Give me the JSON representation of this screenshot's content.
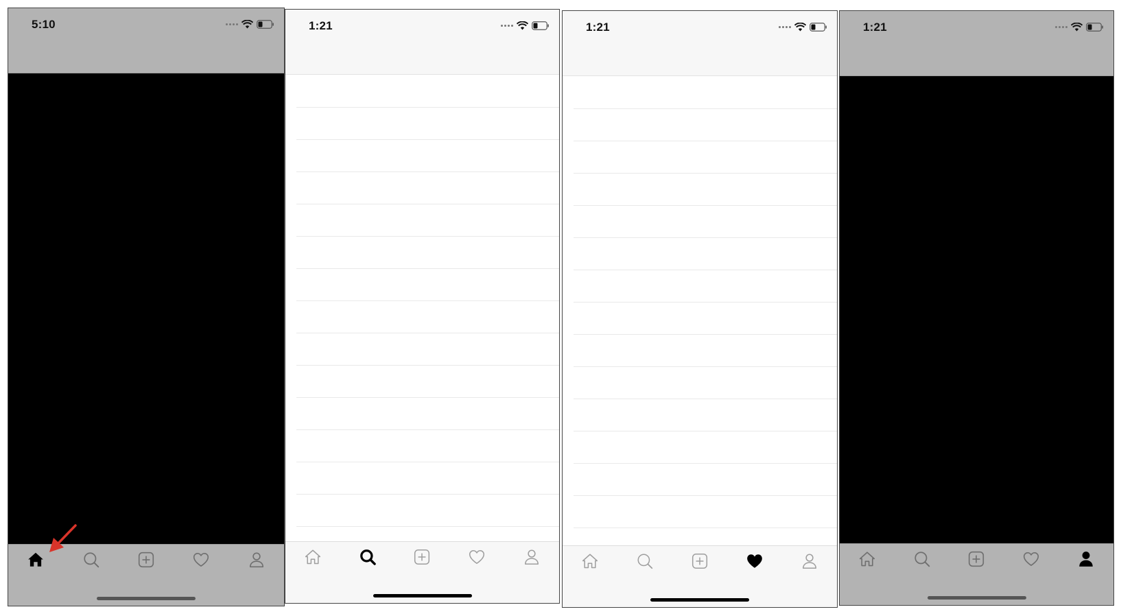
{
  "screens": [
    {
      "time": "5:10",
      "active_tab": "home",
      "overlay": "gray",
      "content": "black",
      "annotation": "red-arrow-pointing-at-home-tab"
    },
    {
      "time": "1:21",
      "active_tab": "search",
      "overlay": "none",
      "content": "empty-list"
    },
    {
      "time": "1:21",
      "active_tab": "activity",
      "overlay": "none",
      "content": "empty-list"
    },
    {
      "time": "1:21",
      "active_tab": "profile",
      "overlay": "gray",
      "content": "black"
    }
  ],
  "tabs": [
    {
      "id": "home",
      "icon": "home-icon"
    },
    {
      "id": "search",
      "icon": "search-icon"
    },
    {
      "id": "add",
      "icon": "add-square-icon"
    },
    {
      "id": "activity",
      "icon": "heart-icon"
    },
    {
      "id": "profile",
      "icon": "person-icon"
    }
  ],
  "colors": {
    "active_icon": "#000000",
    "inactive_icon": "#9e9e9e",
    "inactive_icon_on_gray": "#6f6f6f",
    "overlay_gray": "#b3b3b3",
    "annotation_red": "#d9342a"
  }
}
